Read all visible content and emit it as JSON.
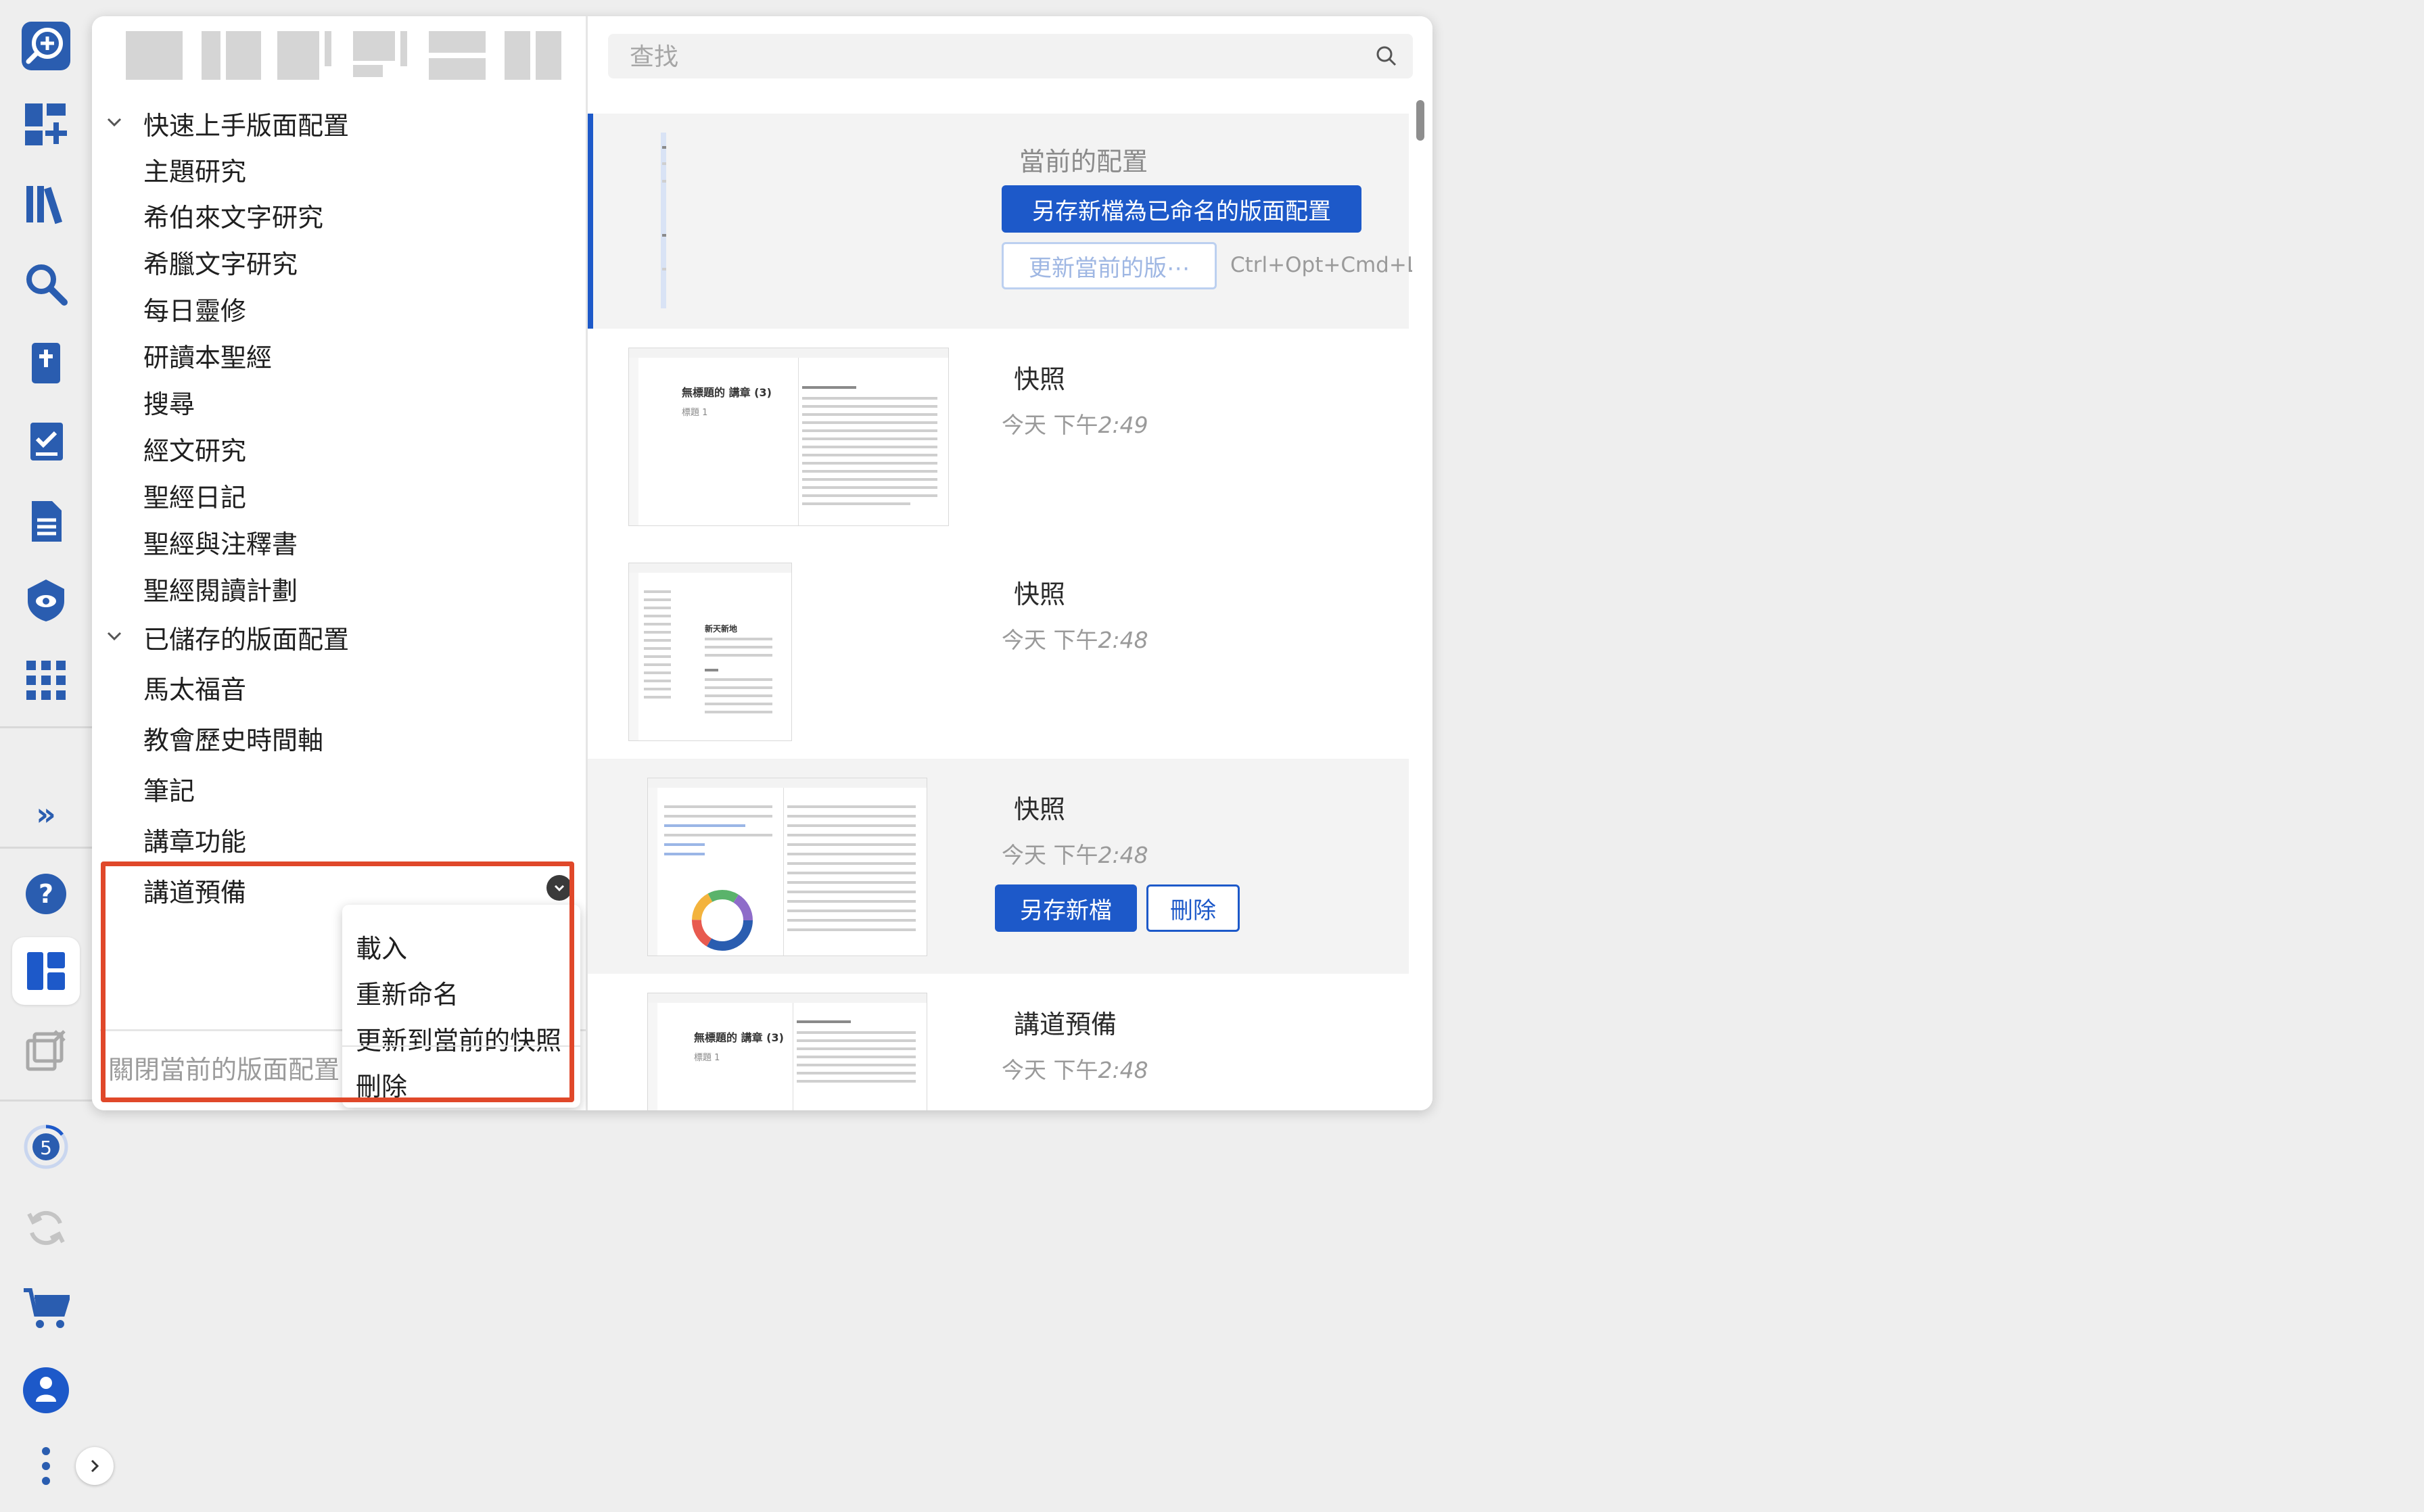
{
  "rail": {
    "icons": [
      "add-guide-icon",
      "dashboard-add-icon",
      "library-icon",
      "search-icon",
      "bible-icon",
      "checklist-icon",
      "document-icon",
      "shield-eye-icon",
      "apps-grid-icon"
    ],
    "more_label": "»",
    "bottom_icons": [
      "help-icon",
      "layouts-icon",
      "close-panels-icon",
      "sync-status-icon",
      "sync-icon",
      "cart-icon",
      "account-icon",
      "more-vert-icon"
    ],
    "sync_badge": "5"
  },
  "search": {
    "placeholder": "查找"
  },
  "tree": {
    "quickstart_label": "快速上手版面配置",
    "quickstart_items": [
      "主題研究",
      "希伯來文字研究",
      "希臘文字研究",
      "每日靈修",
      "研讀本聖經",
      "搜尋",
      "經文研究",
      "聖經日記",
      "聖經與注釋書",
      "聖經閱讀計劃"
    ],
    "saved_label": "已儲存的版面配置",
    "saved_items": [
      "馬太福音",
      "教會歷史時間軸",
      "筆記",
      "講章功能",
      "講道預備"
    ]
  },
  "close_layout_label": "關閉當前的版面配置",
  "context_menu": {
    "items": [
      "載入",
      "重新命名",
      "更新到當前的快照",
      "刪除"
    ]
  },
  "current": {
    "title": "當前的配置",
    "save_as_label": "另存新檔為已命名的版面配置",
    "update_label": "更新當前的版⋯",
    "shortcut": "Ctrl+Opt+Cmd+L"
  },
  "snapshots": [
    {
      "title": "快照",
      "date_prefix": "今天 下午",
      "time": "2:49"
    },
    {
      "title": "快照",
      "date_prefix": "今天 下午",
      "time": "2:48"
    },
    {
      "title": "快照",
      "date_prefix": "今天 下午",
      "time": "2:48",
      "save_label": "另存新檔",
      "delete_label": "刪除"
    },
    {
      "title": "講道預備",
      "date_prefix": "今天 下午",
      "time": "2:48"
    }
  ],
  "thumbnails": {
    "doc_title": "無標題的 講章 (3)",
    "doc_subtitle": "標題 1",
    "verse_heading": "新天新地"
  },
  "colors": {
    "accent": "#1d59c9",
    "highlight": "#e0482a",
    "rail_icon": "#2a5db0"
  }
}
